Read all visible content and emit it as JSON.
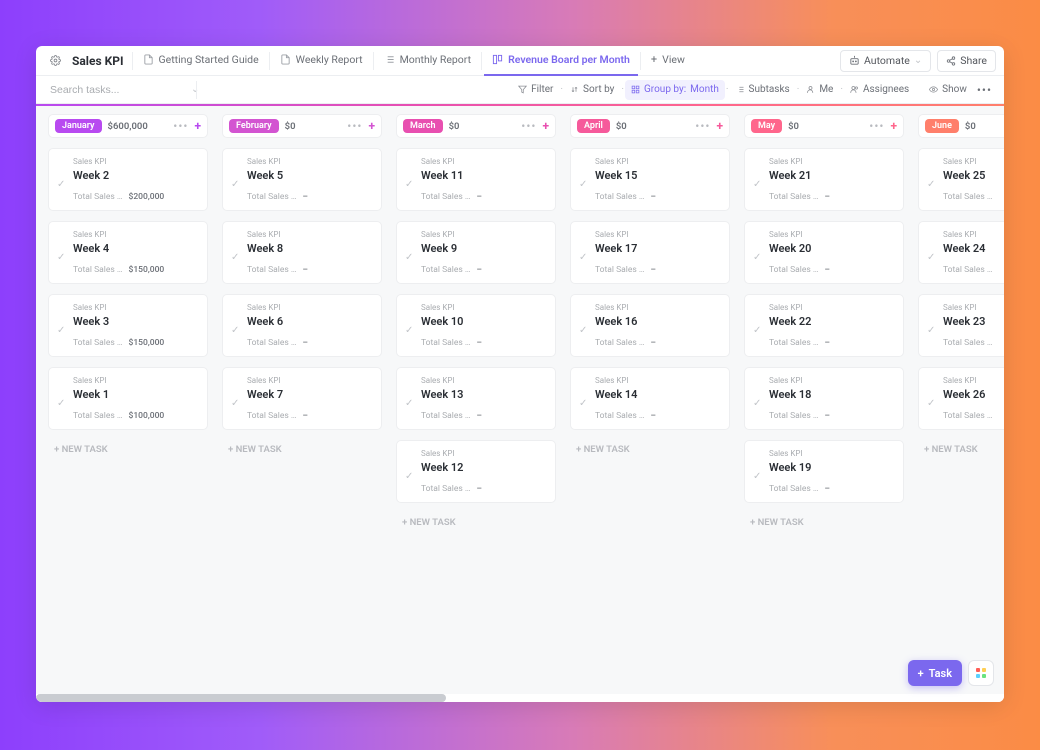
{
  "header": {
    "title": "Sales KPI",
    "tabs": [
      {
        "label": "Getting Started Guide",
        "icon": "doc"
      },
      {
        "label": "Weekly Report",
        "icon": "doc"
      },
      {
        "label": "Monthly Report",
        "icon": "list"
      },
      {
        "label": "Revenue Board per Month",
        "icon": "board",
        "active": true
      },
      {
        "label": "View",
        "icon": "plus"
      }
    ],
    "automate": "Automate",
    "share": "Share"
  },
  "toolbar": {
    "search_placeholder": "Search tasks...",
    "filter": "Filter",
    "sortby": "Sort by",
    "groupby_label": "Group by:",
    "groupby_value": "Month",
    "subtasks": "Subtasks",
    "me": "Me",
    "assignees": "Assignees",
    "show": "Show"
  },
  "common": {
    "field_label": "Total Sales …",
    "breadcrumb": "Sales KPI",
    "new_task": "+ NEW TASK",
    "dash": "–"
  },
  "task_button": "Task",
  "columns": [
    {
      "name": "January",
      "amount": "$600,000",
      "color": "#b84af0",
      "cards": [
        {
          "title": "Week 2",
          "value": "$200,000"
        },
        {
          "title": "Week 4",
          "value": "$150,000"
        },
        {
          "title": "Week 3",
          "value": "$150,000"
        },
        {
          "title": "Week 1",
          "value": "$100,000"
        }
      ]
    },
    {
      "name": "February",
      "amount": "$0",
      "color": "#d354d1",
      "cards": [
        {
          "title": "Week 5",
          "value": "–"
        },
        {
          "title": "Week 8",
          "value": "–"
        },
        {
          "title": "Week 6",
          "value": "–"
        },
        {
          "title": "Week 7",
          "value": "–"
        }
      ]
    },
    {
      "name": "March",
      "amount": "$0",
      "color": "#e84fb0",
      "cards": [
        {
          "title": "Week 11",
          "value": "–"
        },
        {
          "title": "Week 9",
          "value": "–"
        },
        {
          "title": "Week 10",
          "value": "–"
        },
        {
          "title": "Week 13",
          "value": "–"
        },
        {
          "title": "Week 12",
          "value": "–"
        }
      ]
    },
    {
      "name": "April",
      "amount": "$0",
      "color": "#f65a9b",
      "cards": [
        {
          "title": "Week 15",
          "value": "–"
        },
        {
          "title": "Week 17",
          "value": "–"
        },
        {
          "title": "Week 16",
          "value": "–"
        },
        {
          "title": "Week 14",
          "value": "–"
        }
      ]
    },
    {
      "name": "May",
      "amount": "$0",
      "color": "#ff668c",
      "cards": [
        {
          "title": "Week 21",
          "value": "–"
        },
        {
          "title": "Week 20",
          "value": "–"
        },
        {
          "title": "Week 22",
          "value": "–"
        },
        {
          "title": "Week 18",
          "value": "–"
        },
        {
          "title": "Week 19",
          "value": "–"
        }
      ]
    },
    {
      "name": "June",
      "amount": "$0",
      "color": "#ff7f6b",
      "cards": [
        {
          "title": "Week 25",
          "value": ""
        },
        {
          "title": "Week 24",
          "value": ""
        },
        {
          "title": "Week 23",
          "value": ""
        },
        {
          "title": "Week 26",
          "value": ""
        }
      ]
    }
  ]
}
